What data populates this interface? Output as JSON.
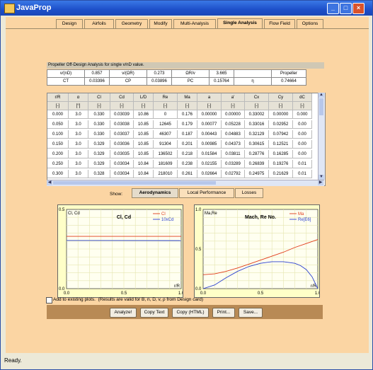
{
  "window": {
    "title": "JavaProp"
  },
  "tabs": [
    "Design",
    "Airfoils",
    "Geometry",
    "Modify",
    "Multi-Analysis",
    "Single Analysis",
    "Flow Field",
    "Options"
  ],
  "active_tab": "Single Analysis",
  "section_header": "Propeller Off-Design Analysis for single v/nD value.",
  "summary": {
    "row1": [
      [
        "v/(nD)",
        "0.857"
      ],
      [
        "v/(ΩR)",
        "0.273"
      ],
      [
        "ΩR/v",
        "3.665"
      ],
      [
        "",
        "Propeller"
      ]
    ],
    "row2": [
      [
        "CT",
        "0.03396"
      ],
      [
        "CP",
        "0.03896"
      ],
      [
        "PC",
        "0.15764"
      ],
      [
        "η",
        "0.74664"
      ]
    ]
  },
  "grid": {
    "headers": [
      "r/R",
      "α",
      "Cl",
      "Cd",
      "L/D",
      "Re",
      "Ma",
      "a",
      "a'",
      "Cx",
      "Cy",
      "dC"
    ],
    "units": [
      "[-]",
      "[°]",
      "[-]",
      "[-]",
      "[-]",
      "[-]",
      "[-]",
      "[-]",
      "[-]",
      "[-]",
      "[-]",
      "[-]"
    ],
    "rows": [
      [
        "0.000",
        "3.0",
        "0.330",
        "0.03039",
        "10.86",
        "0",
        "0.176",
        "0.00000",
        "0.00000",
        "0.33002",
        "0.00000",
        "0.000"
      ],
      [
        "0.050",
        "3.0",
        "0.330",
        "0.03038",
        "10.85",
        "12645",
        "0.179",
        "0.00077",
        "0.05228",
        "0.33016",
        "0.02952",
        "0.00"
      ],
      [
        "0.100",
        "3.0",
        "0.330",
        "0.03037",
        "10.85",
        "46307",
        "0.187",
        "0.00443",
        "0.04883",
        "0.32129",
        "0.07942",
        "0.00"
      ],
      [
        "0.150",
        "3.0",
        "0.329",
        "0.03036",
        "10.85",
        "91304",
        "0.201",
        "0.00985",
        "0.04373",
        "0.30615",
        "0.12521",
        "0.00"
      ],
      [
        "0.200",
        "3.0",
        "0.329",
        "0.03035",
        "10.85",
        "136502",
        "0.218",
        "0.01584",
        "0.03811",
        "0.28776",
        "0.16285",
        "0.00"
      ],
      [
        "0.250",
        "3.0",
        "0.329",
        "0.03034",
        "10.84",
        "181609",
        "0.238",
        "0.02155",
        "0.03289",
        "0.26839",
        "0.19276",
        "0.01"
      ],
      [
        "0.300",
        "3.0",
        "0.328",
        "0.03034",
        "10.84",
        "218010",
        "0.261",
        "0.02664",
        "0.02792",
        "0.24975",
        "0.21629",
        "0.01"
      ]
    ]
  },
  "show_label": "Show:",
  "show_tabs": [
    "Aerodynamics",
    "Local Performance",
    "Losses"
  ],
  "active_show_tab": "Aerodynamics",
  "chart_data": [
    {
      "type": "line",
      "title": "Cl, Cd",
      "ylabel": "Cl, Cd",
      "xlabel": "r/R",
      "xlim": [
        0.0,
        1.0
      ],
      "ylim": [
        0.0,
        0.5
      ],
      "x_ticks": [
        "0.0",
        "0.5",
        "1.0"
      ],
      "y_ticks": [
        "0.0",
        "0.5"
      ],
      "legend_position": "top-right",
      "series": [
        {
          "name": "Cl",
          "color": "#e03a1a",
          "x": [
            0.0,
            1.0
          ],
          "y": [
            0.33,
            0.33
          ]
        },
        {
          "name": "10xCd",
          "color": "#2a3fd0",
          "x": [
            0.0,
            1.0
          ],
          "y": [
            0.304,
            0.303
          ]
        }
      ]
    },
    {
      "type": "line",
      "title": "Mach, Re No.",
      "ylabel": "Ma,Re",
      "xlabel": "r/R",
      "xlim": [
        0.0,
        1.0
      ],
      "ylim": [
        0.0,
        1.0
      ],
      "x_ticks": [
        "0.0",
        "0.5",
        "1.0"
      ],
      "y_ticks": [
        "0.0",
        "0.5",
        "1.0"
      ],
      "legend_position": "top-right",
      "series": [
        {
          "name": "Ma",
          "color": "#e03a1a",
          "x": [
            0.0,
            0.1,
            0.2,
            0.3,
            0.4,
            0.5,
            0.6,
            0.7,
            0.8,
            0.9,
            1.0
          ],
          "y": [
            0.176,
            0.187,
            0.218,
            0.261,
            0.31,
            0.36,
            0.41,
            0.46,
            0.52,
            0.57,
            0.62
          ]
        },
        {
          "name": "Re[E6]",
          "color": "#2a3fd0",
          "x": [
            0.0,
            0.1,
            0.2,
            0.3,
            0.4,
            0.5,
            0.6,
            0.7,
            0.8,
            0.85,
            0.9,
            0.95,
            1.0
          ],
          "y": [
            0.0,
            0.046,
            0.137,
            0.218,
            0.28,
            0.32,
            0.34,
            0.34,
            0.32,
            0.29,
            0.24,
            0.15,
            0.0
          ]
        }
      ]
    }
  ],
  "add_existing": "Add to existing plots.",
  "note": "(Results are valid for B, n, D, v, ρ from Design card)",
  "buttons": [
    "Analyze!",
    "Copy Text",
    "Copy (HTML)",
    "Print...",
    "Save..."
  ],
  "status": "Ready."
}
